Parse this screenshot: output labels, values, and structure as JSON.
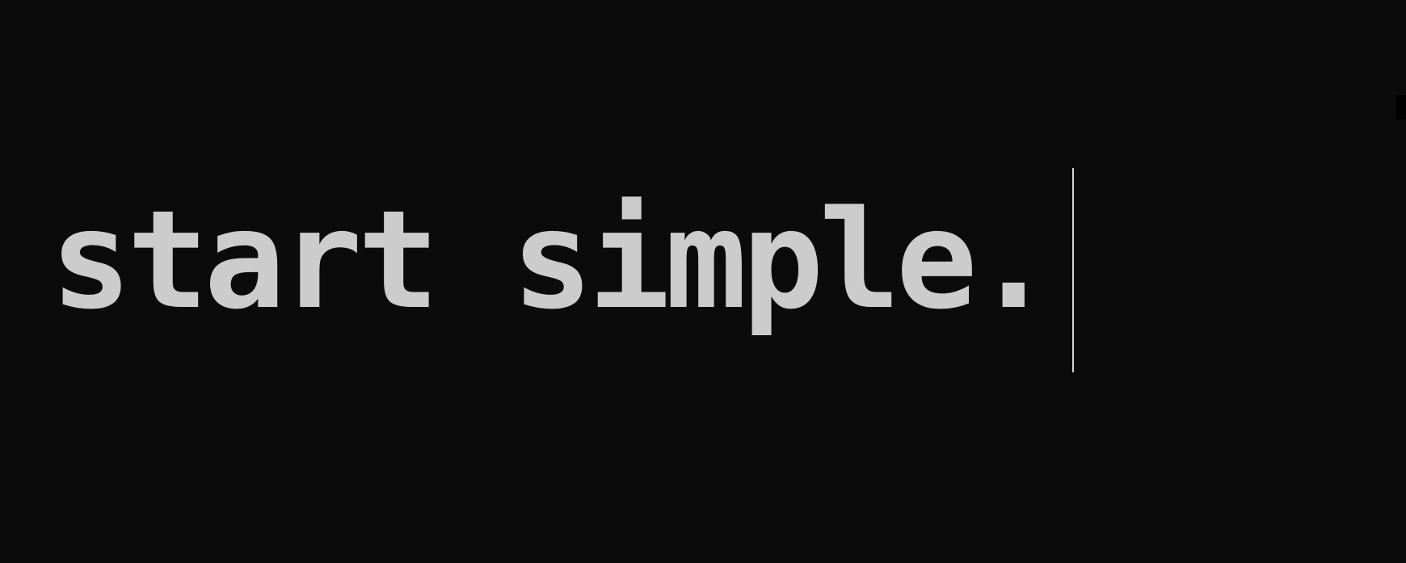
{
  "editor": {
    "text": "start simple."
  },
  "colors": {
    "background": "#0b0b0b",
    "text": "#cccccc",
    "caret": "#d6d6d6"
  }
}
